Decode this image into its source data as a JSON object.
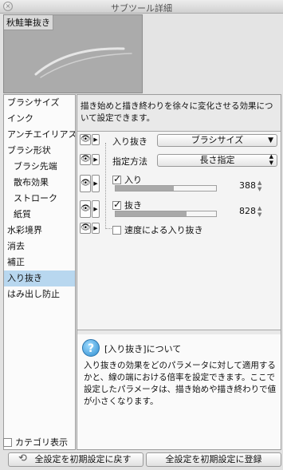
{
  "window": {
    "title": "サブツール詳細"
  },
  "preview": {
    "label": "秋鮭筆抜き"
  },
  "categories": [
    {
      "label": "ブラシサイズ",
      "sub": false,
      "selected": false
    },
    {
      "label": "インク",
      "sub": false,
      "selected": false
    },
    {
      "label": "アンチエイリアス",
      "sub": false,
      "selected": false
    },
    {
      "label": "ブラシ形状",
      "sub": false,
      "selected": false
    },
    {
      "label": "ブラシ先端",
      "sub": true,
      "selected": false
    },
    {
      "label": "散布効果",
      "sub": true,
      "selected": false
    },
    {
      "label": "ストローク",
      "sub": true,
      "selected": false
    },
    {
      "label": "紙質",
      "sub": true,
      "selected": false
    },
    {
      "label": "水彩境界",
      "sub": false,
      "selected": false
    },
    {
      "label": "消去",
      "sub": false,
      "selected": false
    },
    {
      "label": "補正",
      "sub": false,
      "selected": false
    },
    {
      "label": "入り抜き",
      "sub": false,
      "selected": true
    },
    {
      "label": "はみ出し防止",
      "sub": false,
      "selected": false
    }
  ],
  "category_footer": {
    "label": "カテゴリ表示",
    "checked": false
  },
  "description": "描き始めと描き終わりを徐々に変化させる効果について設定できます。",
  "settings": {
    "iri_nuki": {
      "label": "入り抜き",
      "value": "ブラシサイズ"
    },
    "method": {
      "label": "指定方法",
      "value": "長さ指定"
    },
    "iri": {
      "label": "入り",
      "checked": true,
      "value": "388",
      "fill_ratio": 0.58
    },
    "nuki": {
      "label": "抜き",
      "checked": true,
      "value": "828",
      "fill_ratio": 0.71
    },
    "speed": {
      "label": "速度による入り抜き",
      "checked": false
    }
  },
  "help": {
    "title": "[入り抜き]について",
    "body": "入り抜きの効果をどのパラメータに対して適用するかと、線の端における倍率を設定できます。ここで設定したパラメータは、描き始めや描き終わりで値が小さくなります。"
  },
  "buttons": {
    "reset_all": "全設定を初期設定に戻す",
    "register_all": "全設定を初期設定に登録"
  },
  "icons": {
    "eye": "eye-icon",
    "expand": "triangle-right-icon",
    "reset": "reset-icon",
    "help": "question-icon"
  }
}
